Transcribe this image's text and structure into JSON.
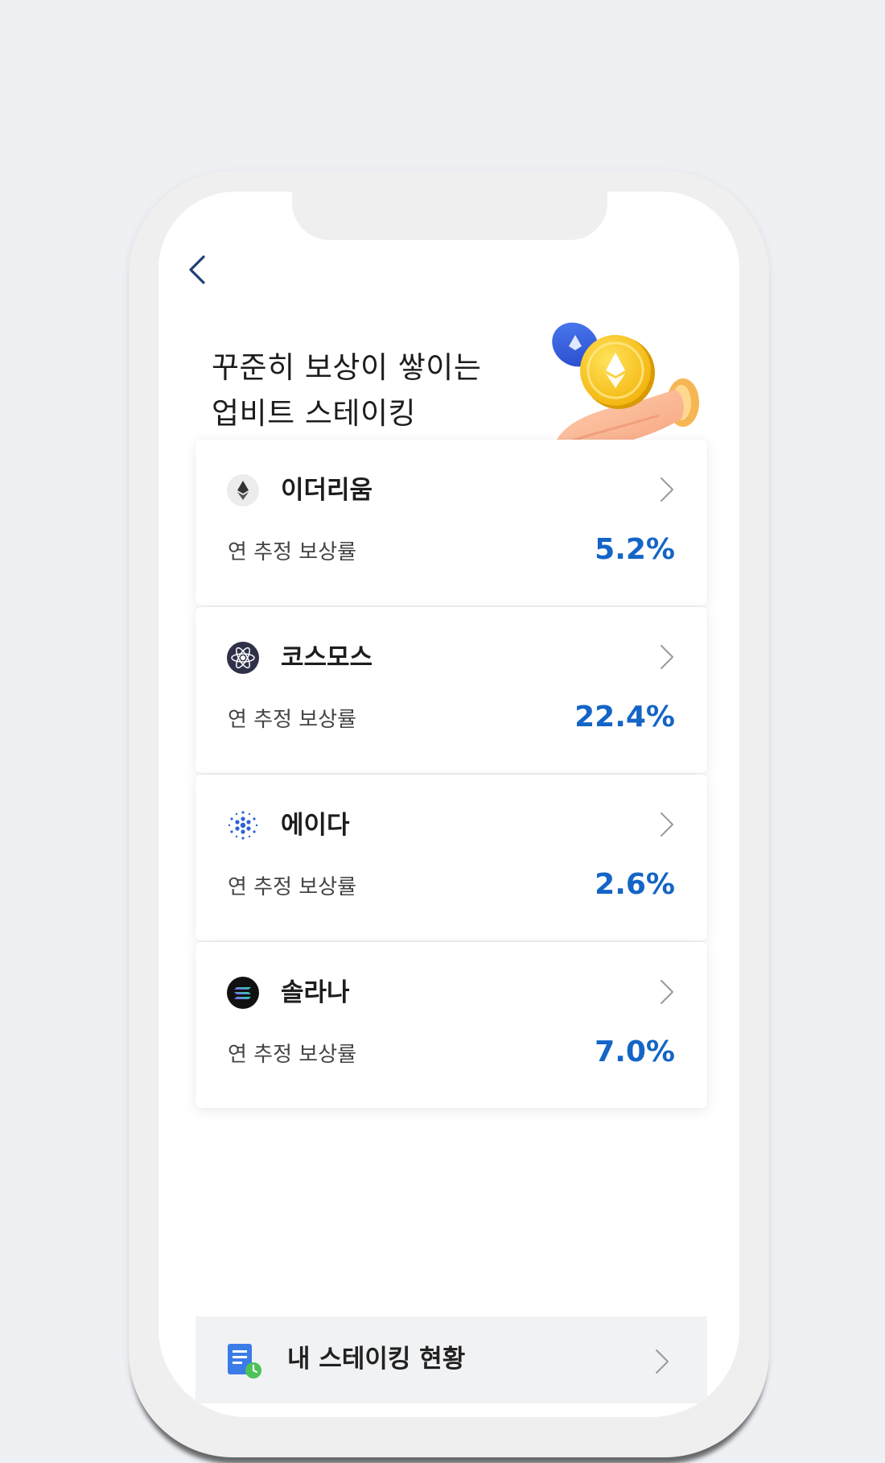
{
  "header": {
    "back_icon": "chevron-left-icon",
    "title_line1": "꾸준히 보상이 쌓이는",
    "title_line2": "업비트 스테이킹"
  },
  "colors": {
    "accent_blue": "#1465c6",
    "background": "#eef0f4",
    "card_background": "#ffffff",
    "bottom_button_background": "#f1f2f4"
  },
  "coins": [
    {
      "name": "이더리움",
      "icon": "ethereum-icon",
      "rate_label": "연 추정 보상률",
      "rate": "5.2%"
    },
    {
      "name": "코스모스",
      "icon": "cosmos-icon",
      "rate_label": "연 추정 보상률",
      "rate": "22.4%"
    },
    {
      "name": "에이다",
      "icon": "cardano-icon",
      "rate_label": "연 추정 보상률",
      "rate": "2.6%"
    },
    {
      "name": "솔라나",
      "icon": "solana-icon",
      "rate_label": "연 추정 보상률",
      "rate": "7.0%"
    }
  ],
  "my_staking": {
    "label": "내 스테이킹 현황",
    "icon": "document-clock-icon"
  }
}
